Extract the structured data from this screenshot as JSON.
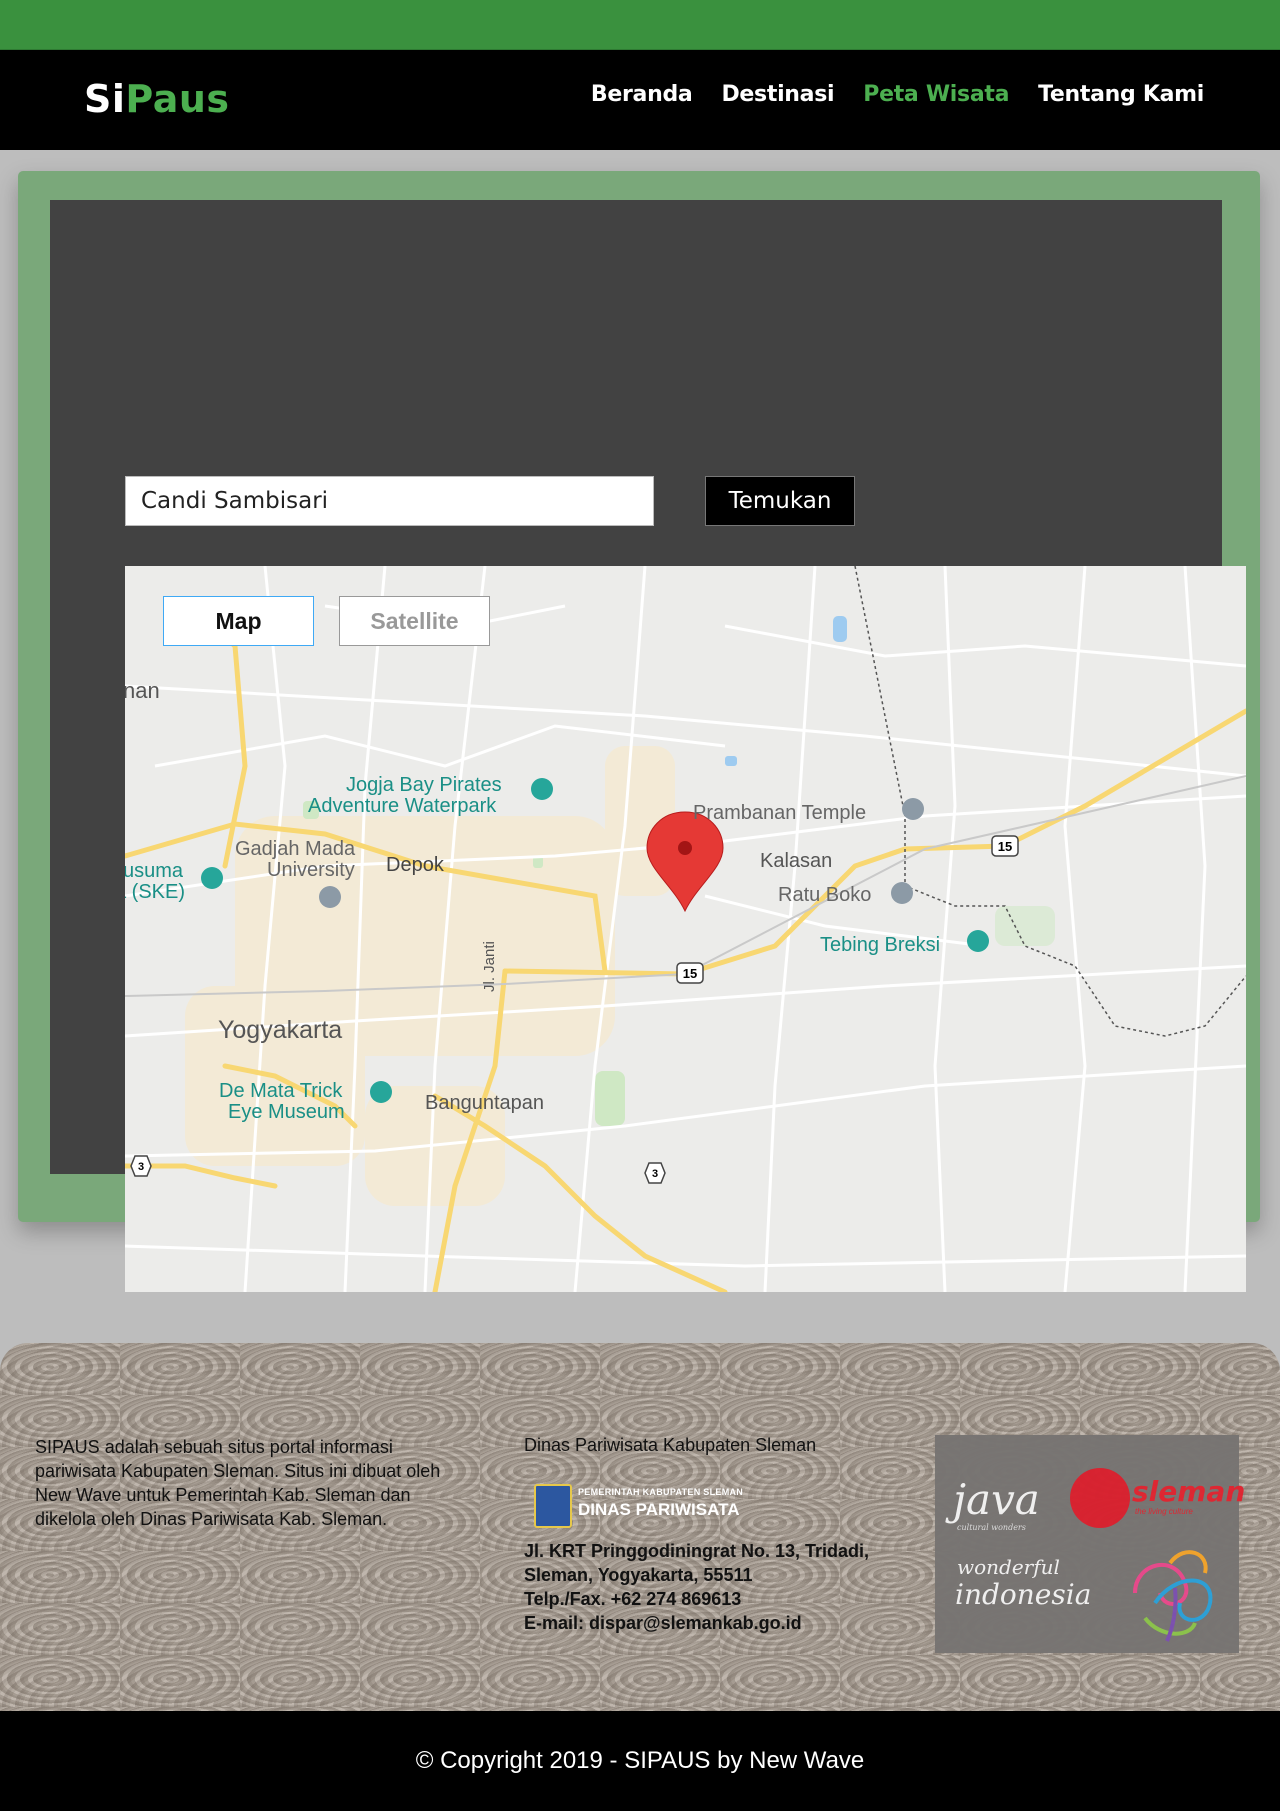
{
  "header": {
    "logo_part1": "Si",
    "logo_part2": "Paus",
    "nav": [
      {
        "label": "Beranda"
      },
      {
        "label": "Destinasi"
      },
      {
        "label": "Peta Wisata"
      },
      {
        "label": "Tentang Kami"
      }
    ],
    "active_nav": "Peta Wisata"
  },
  "search": {
    "value": "Candi Sambisari",
    "button_label": "Temukan"
  },
  "map": {
    "type_buttons": {
      "map": "Map",
      "satellite": "Satellite"
    },
    "selected_type": "Map",
    "places": {
      "jogja_bay_1": "Jogja Bay Pirates",
      "jogja_bay_2": "Adventure Waterpark",
      "prambanan": "Prambanan Temple",
      "gadjah_1": "Gadjah Mada",
      "gadjah_2": "University",
      "depok": "Depok",
      "kalasan": "Kalasan",
      "kusuma_1": "usuma",
      "kusuma_2": "a (SKE)",
      "ratu_boko": "Ratu Boko",
      "tebing": "Tebing Breksi",
      "yogyakarta": "Yogyakarta",
      "jl_janti": "Jl. Janti",
      "de_mata_1": "De Mata Trick",
      "de_mata_2": "Eye Museum",
      "banguntapan": "Banguntapan",
      "left_edge": "nan"
    },
    "route_shields": {
      "r15a": "15",
      "r15b": "15",
      "r3a": "3",
      "r3b": "3"
    },
    "colors": {
      "road_major": "#f8d772",
      "road_minor": "#ffffff",
      "poi_teal": "#26a69a",
      "marker": "#e53935",
      "base": "#ececea"
    }
  },
  "footer": {
    "about": "SIPAUS adalah sebuah situs portal informasi pariwisata Kabupaten Sleman. Situs ini dibuat oleh New Wave untuk Pemerintah Kab. Sleman dan dikelola oleh Dinas Pariwisata Kab. Sleman.",
    "dept_title": "Dinas Pariwisata Kabupaten Sleman",
    "badge_small": "PEMERINTAH KABUPATEN SLEMAN",
    "badge_big": "DINAS PARIWISATA",
    "address_lines": [
      "Jl. KRT Pringgodiningrat No. 13, Tridadi,",
      "Sleman, Yogyakarta, 55511",
      "Telp./Fax. +62 274 869613",
      "E-mail: dispar@slemankab.go.id"
    ],
    "logos": {
      "java": "java",
      "java_sub": "cultural wonders",
      "sleman": "sleman",
      "sleman_sub": "the living culture",
      "wonderful": "wonderful",
      "indonesia": "indonesia"
    }
  },
  "copyright": "© Copyright 2019 - SIPAUS by New Wave"
}
